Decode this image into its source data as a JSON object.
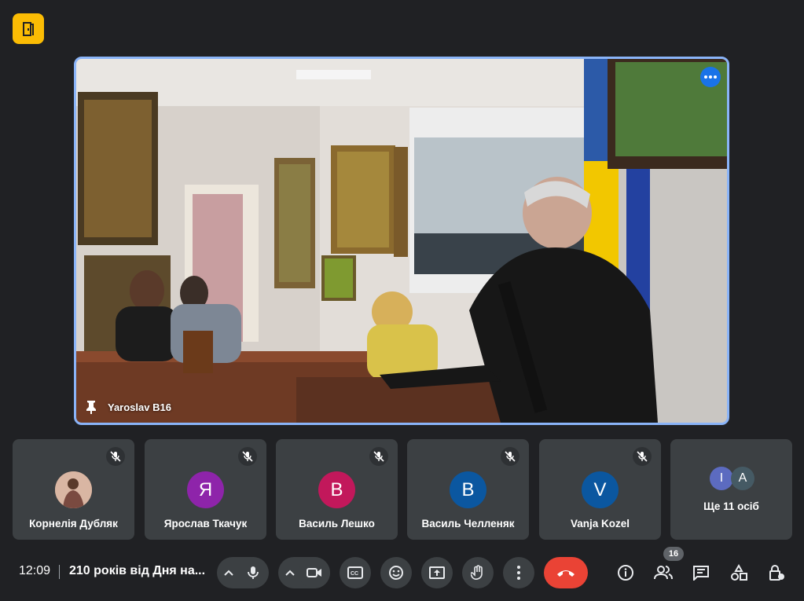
{
  "brand": {
    "icon": "door-exit-icon",
    "color": "#fbbc04"
  },
  "main_video": {
    "participant_name": "Yaroslav B16",
    "pin_icon": "pin-icon",
    "speaking_icon": "speaking-indicator-icon",
    "accent_color": "#8ab4f8"
  },
  "participants": [
    {
      "name": "Корнелія Дубляк",
      "initial": "",
      "avatar_type": "photo",
      "color": "#c48a6c",
      "muted_icon": "mic-off-icon"
    },
    {
      "name": "Ярослав Ткачук",
      "initial": "Я",
      "avatar_type": "initial",
      "color": "#8e24aa",
      "muted_icon": "mic-off-icon"
    },
    {
      "name": "Василь Лешко",
      "initial": "В",
      "avatar_type": "initial",
      "color": "#c2185b",
      "muted_icon": "mic-off-icon"
    },
    {
      "name": "Василь Челленяк",
      "initial": "В",
      "avatar_type": "initial",
      "color": "#0b57a0",
      "muted_icon": "mic-off-icon"
    },
    {
      "name": "Vanja Kozel",
      "initial": "V",
      "avatar_type": "initial",
      "color": "#0b57a0",
      "muted_icon": "mic-off-icon"
    }
  ],
  "more": {
    "initials": [
      "I",
      "A"
    ],
    "colors": [
      "#5c6bc0",
      "#455a64"
    ],
    "label": "Ще 11 осіб"
  },
  "bottom_bar": {
    "time": "12:09",
    "meeting_title": "210 років від Дня на...",
    "people_count": "16",
    "end_call_color": "#ea4335"
  }
}
